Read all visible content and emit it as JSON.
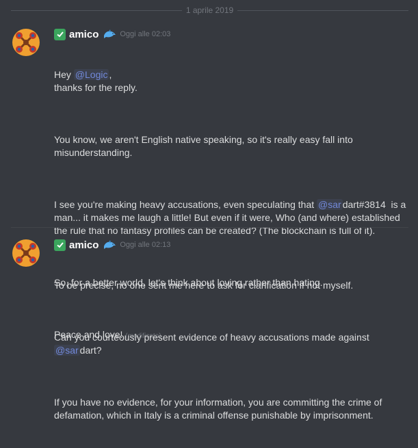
{
  "divider": {
    "date": "1 aprile 2019"
  },
  "messages": [
    {
      "username": "amico",
      "timestamp": "Oggi alle 02:03",
      "line1_prefix": "Hey ",
      "line1_mention": "@Logic",
      "line1_suffix": ",",
      "line2": "thanks for the reply.",
      "para2": "You know, we aren't English native speaking, so it's really easy fall into\nmisunderstanding.",
      "para3_a": "I see you're making heavy accusations, even speculating that ",
      "para3_mention": "@sar",
      "para3_b": "dart#3814  is a\nman... it makes me laugh a little! But even if it were, Who (and where) established\nthe rule that no fantasy profiles can be created? (The blockchain is full of it).",
      "para4": "So, for a better world, let's think about loving rather than hating.",
      "para5": "Peace and love!",
      "edited": "(modificato)"
    },
    {
      "username": "amico",
      "timestamp": "Oggi alle 02:13",
      "para1": "To be precise, no one sent me here to ask for clarification if not myself.",
      "para2": "Can you courteously present evidence of heavy accusations made against",
      "para2_mention": "@sar",
      "para2_suffix": "dart?",
      "para3": "If you have no evidence, for your information, you are committing the crime of\ndefamation, which in Italy is a criminal offense punishable by imprisonment."
    }
  ],
  "colors": {
    "background": "#36393f",
    "mention": "#7289da",
    "verified": "#3ba55d"
  },
  "icons": [
    "avatar-icon",
    "verified-check-icon",
    "dolphin-emoji-icon"
  ]
}
